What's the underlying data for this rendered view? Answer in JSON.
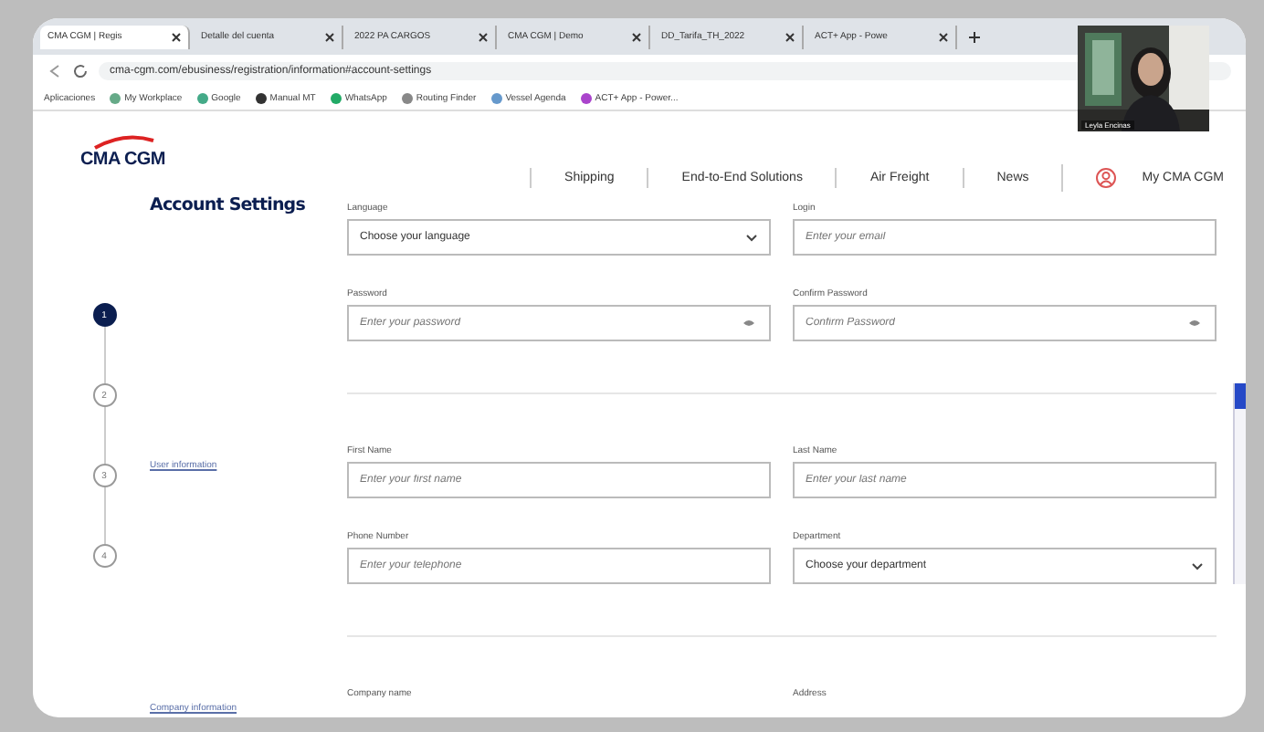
{
  "browser": {
    "tabs": [
      {
        "label": "CMA CGM | Regis",
        "selected": true
      },
      {
        "label": "Detalle del cuenta",
        "selected": false
      },
      {
        "label": "2022 PA CARGOS",
        "selected": false
      },
      {
        "label": "CMA CGM | Demo",
        "selected": false
      },
      {
        "label": "DD_Tarifa_TH_2022",
        "selected": false
      },
      {
        "label": "ACT+ App - Powe",
        "selected": false
      }
    ],
    "address": "cma-cgm.com/ebusiness/registration/information#account-settings",
    "bookmarks": [
      "Aplicaciones",
      "My Workplace",
      "Google",
      "Manual MT",
      "WhatsApp",
      "Routing Finder",
      "Vessel Agenda",
      "ACT+ App - Power..."
    ]
  },
  "video_tile": {
    "kind": "picture",
    "name": "Leyla Encinas"
  },
  "site": {
    "logo": "CMA CGM",
    "nav": [
      "Shipping",
      "End-to-End Solutions",
      "Air Freight",
      "News"
    ],
    "account": "My CMA CGM"
  },
  "steps": [
    {
      "number": "1",
      "selected": true
    },
    {
      "number": "2",
      "selected": false
    },
    {
      "number": "3",
      "selected": false
    },
    {
      "number": "4",
      "selected": false
    }
  ],
  "sections": [
    {
      "heading": "Account Settings",
      "kind": "title",
      "fields": [
        {
          "label": "Language",
          "kind": "select",
          "value": "Choose your language"
        },
        {
          "label": "Login",
          "kind": "text",
          "placeholder": "Enter your email"
        },
        {
          "label": "Password",
          "kind": "password",
          "placeholder": "Enter your password"
        },
        {
          "label": "Confirm Password",
          "kind": "password",
          "placeholder": "Confirm Password"
        }
      ]
    },
    {
      "heading": "User information",
      "kind": "link",
      "fields": [
        {
          "label": "First Name",
          "kind": "text",
          "placeholder": "Enter your first name"
        },
        {
          "label": "Last Name",
          "kind": "text",
          "placeholder": "Enter your last name"
        },
        {
          "label": "Phone Number",
          "kind": "text",
          "placeholder": "Enter your telephone"
        },
        {
          "label": "Department",
          "kind": "select",
          "value": "Choose your department"
        }
      ]
    },
    {
      "heading": "Company information",
      "kind": "link",
      "fields": [
        {
          "label": "Company name",
          "kind": "label_only"
        },
        {
          "label": "Address",
          "kind": "label_only"
        }
      ]
    }
  ]
}
